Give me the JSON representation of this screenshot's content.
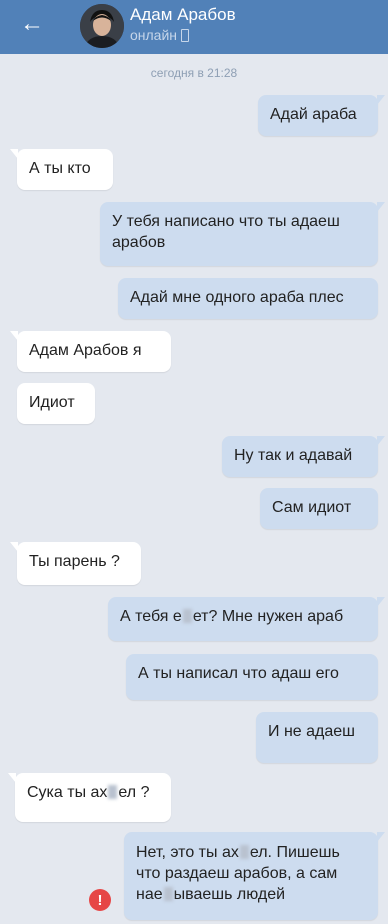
{
  "header": {
    "contact_name": "Адам Арабов",
    "status": "онлайн"
  },
  "icons": {
    "back": "arrow-left-icon",
    "online_device": "mobile-phone-icon",
    "error": "exclamation-circle-icon"
  },
  "colors": {
    "header_bg": "#5181b8",
    "chat_bg": "#e4e8ef",
    "outgoing_bubble": "#cddcef",
    "incoming_bubble": "#ffffff",
    "error_red": "#e64646"
  },
  "chat": {
    "date_separator": "сегодня в 21:28",
    "messages": [
      {
        "dir": "out",
        "text": "Адай араба"
      },
      {
        "dir": "in",
        "text": "А ты кто"
      },
      {
        "dir": "out",
        "text": "У тебя написано что ты адаеш арабов"
      },
      {
        "dir": "out",
        "text": "Адай мне одного араба плес"
      },
      {
        "dir": "in",
        "text": "Адам Арабов  я"
      },
      {
        "dir": "in",
        "text": "Идиот"
      },
      {
        "dir": "out",
        "text": "Ну так и адавай"
      },
      {
        "dir": "out",
        "text": "Сам идиот"
      },
      {
        "dir": "in",
        "text": "Ты парень ?"
      },
      {
        "dir": "out",
        "parts": [
          "А тебя е",
          "ет? Мне нужен араб"
        ]
      },
      {
        "dir": "out",
        "text": "А ты написал что адаш его"
      },
      {
        "dir": "out",
        "text": "И не адаеш"
      },
      {
        "dir": "in",
        "parts": [
          "Сука ты ах",
          "ел ?"
        ]
      },
      {
        "dir": "out",
        "parts": [
          "Нет, это ты ах",
          "ел. Пишешь что раздаеш арабов, а сам нае",
          "ываешь людей"
        ],
        "failed": true
      }
    ],
    "error_mark": "!"
  }
}
